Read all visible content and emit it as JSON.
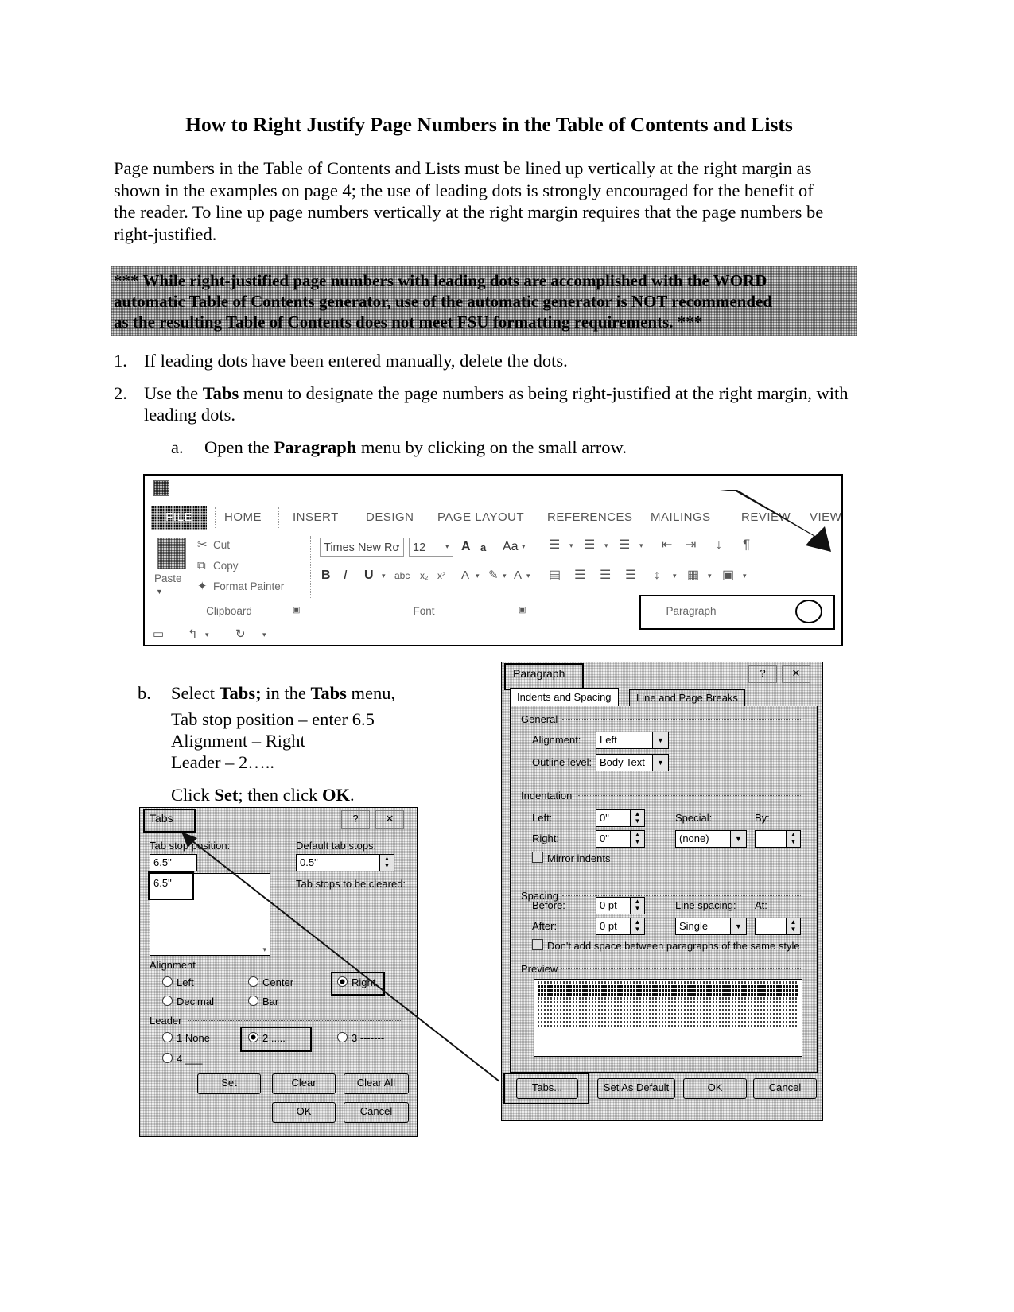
{
  "document": {
    "title": "How to Right Justify Page Numbers in the Table of Contents and Lists",
    "intro": "Page numbers in the Table of Contents and Lists must be lined up vertically at the right margin as shown in the examples on page 4; the use of leading dots is strongly encouraged for the benefit of the reader. To line up page numbers vertically at the right margin requires that the page numbers be right-justified.",
    "warning": {
      "line1": "*** While right-justified page numbers with leading dots are accomplished with the WORD",
      "line2": "automatic Table of Contents generator, use of the automatic generator is NOT recommended",
      "line3": "as the resulting Table of Contents does not meet FSU formatting requirements. ***"
    },
    "steps": [
      {
        "num": "1.",
        "text": "If leading dots have been entered manually, delete the dots."
      },
      {
        "num": "2.",
        "pre": "Use the ",
        "bold": "Tabs",
        "post": " menu to designate the page numbers as being right-justified at the right margin, with leading dots."
      }
    ],
    "substep_a": {
      "num": "a.",
      "pre": "Open the ",
      "bold": "Paragraph",
      "post": " menu by clicking on the small arrow."
    },
    "substep_b": {
      "num": "b.",
      "pre": "Select ",
      "bold1": "Tabs;",
      "mid": " in the ",
      "bold2": "Tabs",
      "post": " menu,",
      "line_tab": "Tab stop position – enter 6.5",
      "line_align": "Alignment – Right",
      "line_leader": "Leader – 2…..",
      "click_pre": "Click ",
      "click_bold1": "Set",
      "click_mid": "; then click ",
      "click_bold2": "OK",
      "click_post": "."
    }
  },
  "ribbon": {
    "quick_access_icon": "word-document-icon",
    "tabs": [
      "FILE",
      "HOME",
      "INSERT",
      "DESIGN",
      "PAGE LAYOUT",
      "REFERENCES",
      "MAILINGS",
      "REVIEW",
      "VIEW"
    ],
    "active_tab": "FILE",
    "clipboard": {
      "group_label": "Clipboard",
      "paste_label": "Paste",
      "cut_label": "Cut",
      "copy_label": "Copy",
      "format_painter_label": "Format Painter"
    },
    "font": {
      "group_label": "Font",
      "font_name": "Times New Ro",
      "font_size": "12",
      "grow_label": "A",
      "shrink_label": "a",
      "change_case_label": "Aa",
      "bold_label": "B",
      "italic_label": "I",
      "underline_label": "U",
      "strikethrough_label": "abc",
      "subscript_label": "x₂",
      "superscript_label": "x²"
    },
    "paragraph": {
      "group_label": "Paragraph",
      "pilcrow_label": "¶",
      "sort_label": "↓"
    }
  },
  "paragraph_dialog": {
    "title": "Paragraph",
    "help_button": "?",
    "close_button": "✕",
    "tabs": [
      "Indents and Spacing",
      "Line and Page Breaks"
    ],
    "active_tab": "Indents and Spacing",
    "general": {
      "legend": "General",
      "alignment_label": "Alignment:",
      "alignment_value": "Left",
      "outline_label": "Outline level:",
      "outline_value": "Body Text"
    },
    "indentation": {
      "legend": "Indentation",
      "left_label": "Left:",
      "left_value": "0\"",
      "right_label": "Right:",
      "right_value": "0\"",
      "special_label": "Special:",
      "special_value": "(none)",
      "by_label": "By:",
      "by_value": "",
      "mirror_label": "Mirror indents"
    },
    "spacing": {
      "legend": "Spacing",
      "before_label": "Before:",
      "before_value": "0 pt",
      "after_label": "After:",
      "after_value": "0 pt",
      "line_spacing_label": "Line spacing:",
      "line_spacing_value": "Single",
      "at_label": "At:",
      "at_value": "",
      "dont_add_label": "Don't add space between paragraphs of the same style"
    },
    "preview": {
      "legend": "Preview"
    },
    "buttons": {
      "tabs": "Tabs...",
      "set_as_default": "Set As Default",
      "ok": "OK",
      "cancel": "Cancel"
    }
  },
  "tabs_dialog": {
    "title": "Tabs",
    "help_button": "?",
    "close_button": "✕",
    "tab_stop_position_label": "Tab stop position:",
    "tab_stop_position_value": "6.5\"",
    "tab_stop_list_item": "6.5\"",
    "default_tab_stops_label": "Default tab stops:",
    "default_tab_stops_value": "0.5\"",
    "to_be_cleared_label": "Tab stops to be cleared:",
    "alignment": {
      "legend": "Alignment",
      "options": [
        "Left",
        "Center",
        "Right",
        "Decimal",
        "Bar"
      ],
      "selected": "Right"
    },
    "leader": {
      "legend": "Leader",
      "options": [
        "1 None",
        "2 .....",
        "3 -------",
        "4 ___"
      ],
      "selected": "2 ....."
    },
    "buttons": {
      "set": "Set",
      "clear": "Clear",
      "clear_all": "Clear All",
      "ok": "OK",
      "cancel": "Cancel"
    }
  }
}
